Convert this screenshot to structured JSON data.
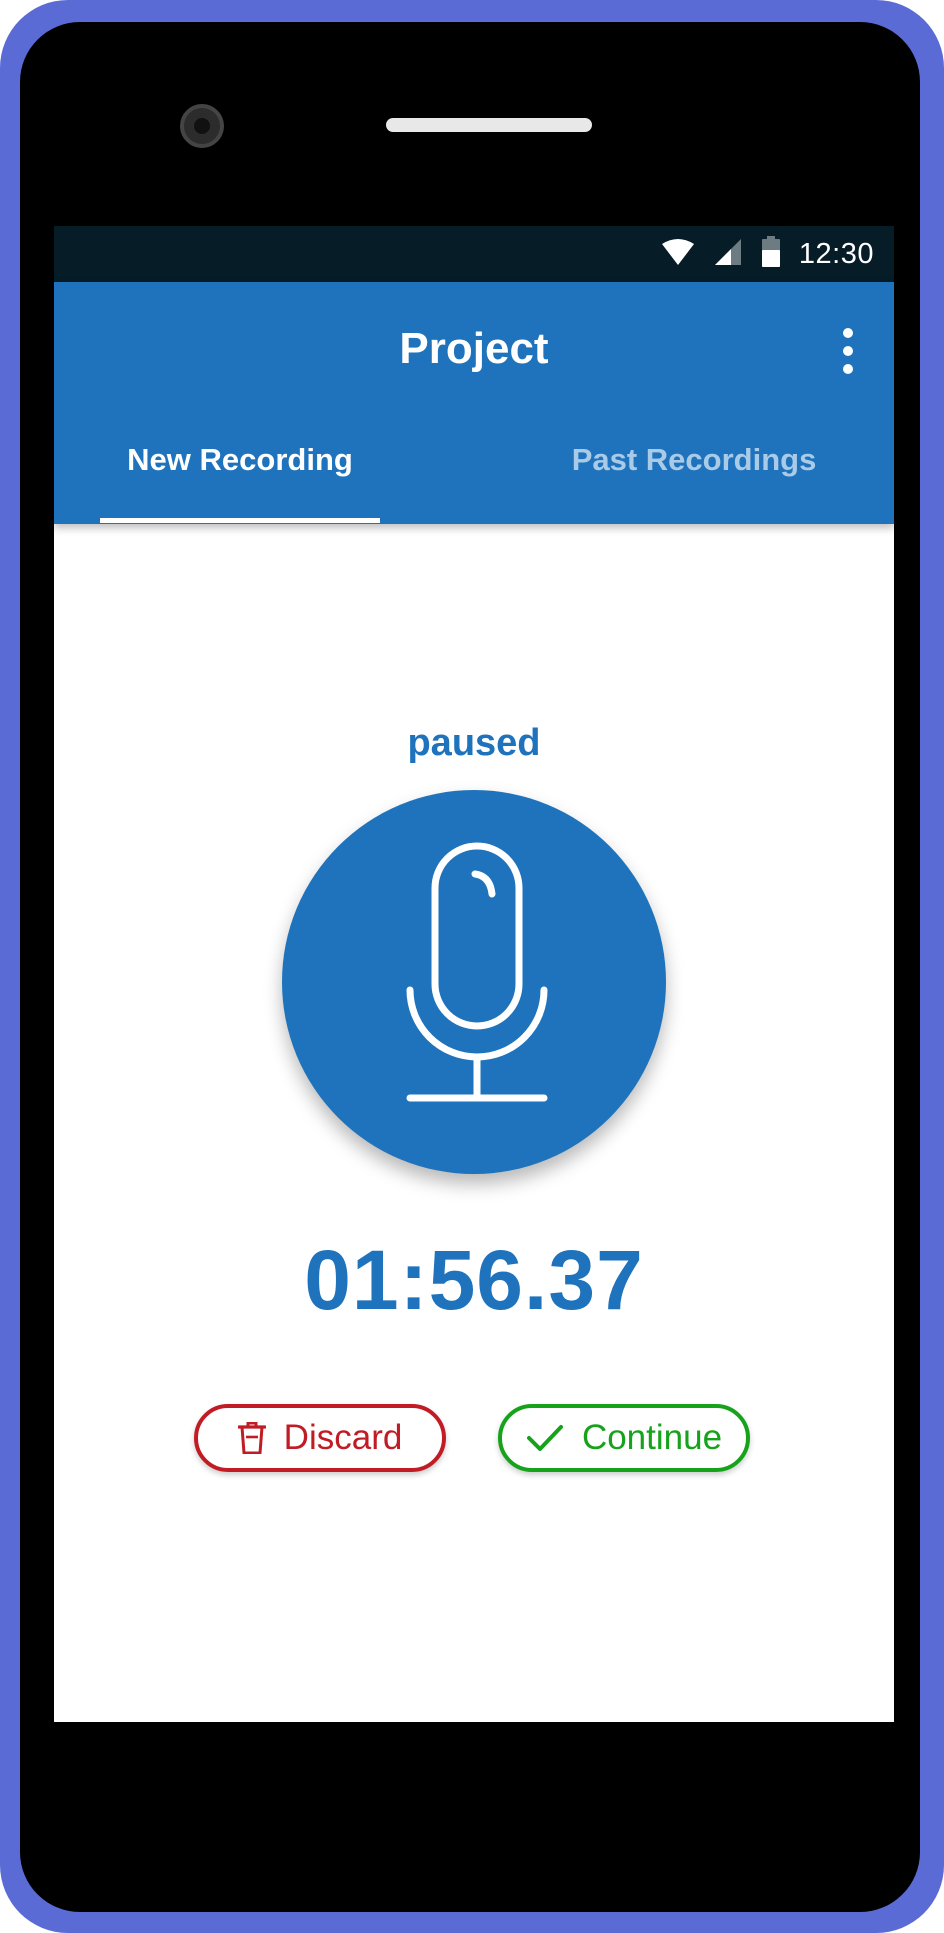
{
  "status_bar": {
    "time": "12:30",
    "icons": [
      "wifi-icon",
      "signal-icon",
      "battery-icon"
    ]
  },
  "app_bar": {
    "title": "Project",
    "menu_icon": "more-vertical-icon"
  },
  "tabs": [
    {
      "label": "New Recording",
      "active": true
    },
    {
      "label": "Past Recordings",
      "active": false
    }
  ],
  "recorder": {
    "state_label": "paused",
    "mic_icon": "microphone-icon",
    "timer": "01:56.37"
  },
  "actions": {
    "discard_label": "Discard",
    "discard_icon": "trash-icon",
    "continue_label": "Continue",
    "continue_icon": "check-icon"
  },
  "colors": {
    "primary": "#1e73bc",
    "status_bar": "#061c26",
    "discard": "#c11c25",
    "continue": "#17a21c",
    "frame": "#5b6bd6"
  }
}
